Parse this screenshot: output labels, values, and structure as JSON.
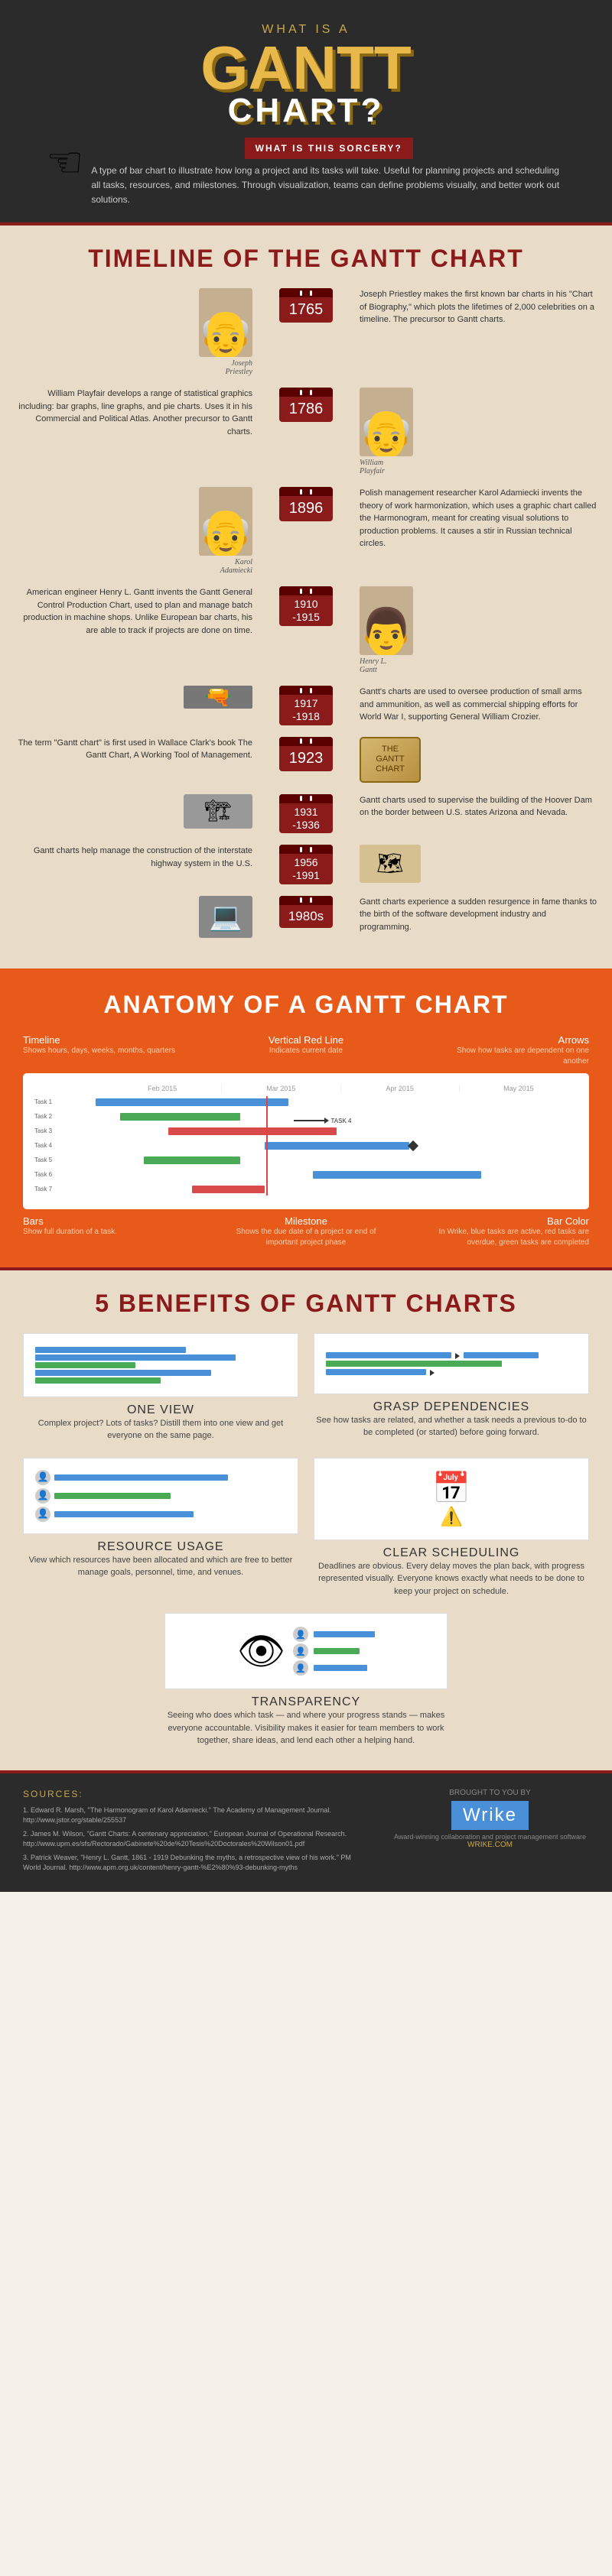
{
  "header": {
    "what_is_label": "WHAT IS A",
    "title_line1": "GANTT",
    "title_line2": "CHART?",
    "sorcery_label": "WHAT IS THIS SORCERY?",
    "description": "A type of bar chart to illustrate how long a project and its tasks will take. Useful for planning projects and scheduling all tasks, resources, and milestones. Through visualization, teams can define problems visually, and better work out solutions."
  },
  "timeline": {
    "section_title": "TIMELINE OF THE GANTT CHART",
    "events": [
      {
        "year": "1765",
        "side": "left",
        "person": "Joseph Priestley",
        "text": "Joseph Priestley makes the first known bar charts in his \"Chart of Biography,\" which plots the lifetimes of 2,000 celebrities on a timeline. The precursor to Gantt charts.",
        "emoji": "👨"
      },
      {
        "year": "1786",
        "side": "right",
        "person": "William Playfair",
        "text": "William Playfair develops a range of statistical graphics including: bar graphs, line graphs, and pie charts. Uses it in his Commercial and Political Atlas. Another precursor to Gantt charts.",
        "emoji": "👴"
      },
      {
        "year": "1896",
        "side": "left",
        "person": "Karol Adamiecki",
        "text": "Polish management researcher Karol Adamiecki invents the theory of work harmonization, which uses a graphic chart called the Harmonogram, meant for creating visual solutions to production problems. It causes a stir in Russian technical circles.",
        "emoji": "👨‍🦳"
      },
      {
        "year": "1910\n-1915",
        "side": "right",
        "person": "Henry L. Gantt",
        "text": "American engineer Henry L. Gantt invents the Gantt General Control Production Chart, used to plan and manage batch production in machine shops. Unlike European bar charts, his are able to track if projects are done on time.",
        "emoji": "👨"
      },
      {
        "year": "1917\n-1918",
        "side": "left",
        "text": "Gantt's charts are used to oversee production of small arms and ammunition, as well as commercial shipping efforts for World War I, supporting General William Crozier.",
        "emoji": "🔫"
      },
      {
        "year": "1923",
        "side": "right",
        "text": "The term \"Gantt chart\" is first used in Wallace Clark's book The Gantt Chart, A Working Tool of Management.",
        "emoji": "📜"
      },
      {
        "year": "1931\n-1936",
        "side": "left",
        "text": "Gantt charts used to supervise the building of the Hoover Dam on the border between U.S. states Arizona and Nevada.",
        "emoji": "🏗"
      },
      {
        "year": "1956\n-1991",
        "side": "right",
        "text": "Gantt charts help manage the construction of the interstate highway system in the U.S.",
        "emoji": "🗺"
      },
      {
        "year": "1980s",
        "side": "left",
        "text": "Gantt charts experience a sudden resurgence in fame thanks to the birth of the software development industry and programming.",
        "emoji": "💻"
      }
    ]
  },
  "anatomy": {
    "section_title": "ANATOMY OF A GANTT CHART",
    "labels": [
      {
        "name": "Timeline",
        "desc": "Shows hours, days, weeks, months, quarters"
      },
      {
        "name": "Vertical Red Line",
        "desc": "Indicates current date"
      },
      {
        "name": "Arrows",
        "desc": "Show how tasks are dependent on one another"
      }
    ],
    "labels_bottom": [
      {
        "name": "Bars",
        "desc": "Show full duration of a task."
      },
      {
        "name": "Milestone",
        "desc": "Shows the due date of a project or end of important project phase"
      },
      {
        "name": "Bar Color",
        "desc": "In Wrike, blue tasks are active, red tasks are overdue, green tasks are completed"
      }
    ]
  },
  "benefits": {
    "section_title": "5 BENEFITS OF GANTT CHARTS",
    "items": [
      {
        "id": "one-view",
        "title": "ONE VIEW",
        "desc": "Complex project? Lots of tasks? Distill them into one view and get everyone on the same page."
      },
      {
        "id": "grasp-dependencies",
        "title": "GRASP DEPENDENCIES",
        "desc": "See how tasks are related, and whether a task needs a previous to-do to be completed (or started) before going forward."
      },
      {
        "id": "resource-usage",
        "title": "RESOURCE USAGE",
        "desc": "View which resources have been allocated and which are free to better manage goals, personnel, time, and venues."
      },
      {
        "id": "clear-scheduling",
        "title": "CLEAR SCHEDULING",
        "desc": "Deadlines are obvious. Every delay moves the plan back, with progress represented visually. Everyone knows exactly what needs to be done to keep your project on schedule."
      },
      {
        "id": "transparency",
        "title": "TRANSPARENCY",
        "desc": "Seeing who does which task — and where your progress stands — makes everyone accountable. Visibility makes it easier for team members to work together, share ideas, and lend each other a helping hand."
      }
    ]
  },
  "footer": {
    "sources_title": "SOURCES:",
    "sources": [
      "1. Edward R. Marsh, \"The Harmonogram of Karol Adamiecki.\" The Academy of Management Journal. http://www.jstor.org/stable/255537",
      "2. James M. Wilson, \"Gantt Charts: A centenary appreciation.\" European Journal of Operational Research. http://www.upm.es/sfs/Rectorado/Gabinete%20de%20Tesis%20Doctorales%20Wilson01.pdf",
      "3. Patrick Weaver, \"Henry L. Gantt, 1861 - 1919 Debunking the myths, a retrospective view of his work.\" PM World Journal. http://www.apm.org.uk/content/henry-gantt-%E2%80%93-debunking-myths"
    ],
    "brought_to_you_by": "BROUGHT TO YOU BY",
    "wrike_name": "Wrike",
    "wrike_tagline": "Award-winning collaboration and project management software",
    "wrike_url": "WRIKE.COM"
  }
}
